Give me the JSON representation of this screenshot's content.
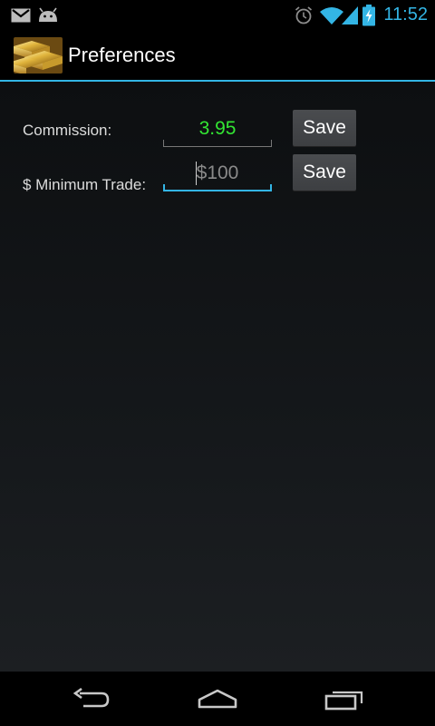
{
  "status_bar": {
    "time": "11:52",
    "accent_color": "#33b5e5",
    "left_icons": [
      "gmail-icon",
      "android-icon"
    ],
    "right_icons": [
      "alarm-icon",
      "wifi-icon",
      "signal-icon",
      "battery-charging-icon"
    ]
  },
  "action_bar": {
    "title": "Preferences",
    "icon": "gold-bars-icon",
    "divider_color": "#33b5e5"
  },
  "preferences": {
    "commission": {
      "label": "Commission:",
      "value": "3.95",
      "value_color": "#33e633",
      "button_label": "Save"
    },
    "minimum_trade": {
      "label": "$ Minimum Trade:",
      "placeholder": "$100",
      "value": "",
      "button_label": "Save",
      "focused": true
    }
  },
  "nav_bar": {
    "buttons": [
      "back-icon",
      "home-icon",
      "recent-apps-icon"
    ]
  }
}
